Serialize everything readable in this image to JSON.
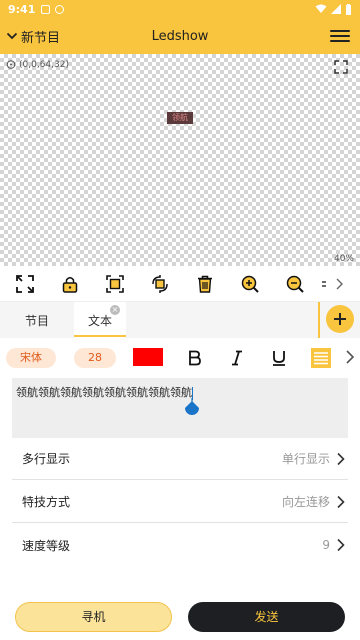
{
  "status_bar": {
    "time": "9:41"
  },
  "header": {
    "back_label": "新节目",
    "title": "Ledshow"
  },
  "canvas": {
    "coords": "(0,0,64,32)",
    "preview_text": "领航",
    "zoom": "40%"
  },
  "toolbar": {
    "icons": [
      "resize-icon",
      "lock-icon",
      "fit-icon",
      "rotate-icon",
      "delete-icon",
      "zoom-in-icon",
      "zoom-out-icon",
      "more-icon"
    ]
  },
  "tabs": [
    {
      "label": "节目"
    },
    {
      "label": "文本"
    }
  ],
  "format": {
    "font": "宋体",
    "size": "28",
    "text_color": "#FF0000"
  },
  "text_input": {
    "value": "领航领航领航领航领航领航领航领航"
  },
  "settings": [
    {
      "label": "多行显示",
      "value": "单行显示"
    },
    {
      "label": "特技方式",
      "value": "向左连移"
    },
    {
      "label": "速度等级",
      "value": "9"
    }
  ],
  "buttons": {
    "find": "寻机",
    "send": "发送"
  },
  "colors": {
    "brand_yellow": "#F9C43E",
    "dark": "#1D1F22",
    "chip_bg": "#FFE7D6",
    "chip_text": "#E05A1C"
  }
}
